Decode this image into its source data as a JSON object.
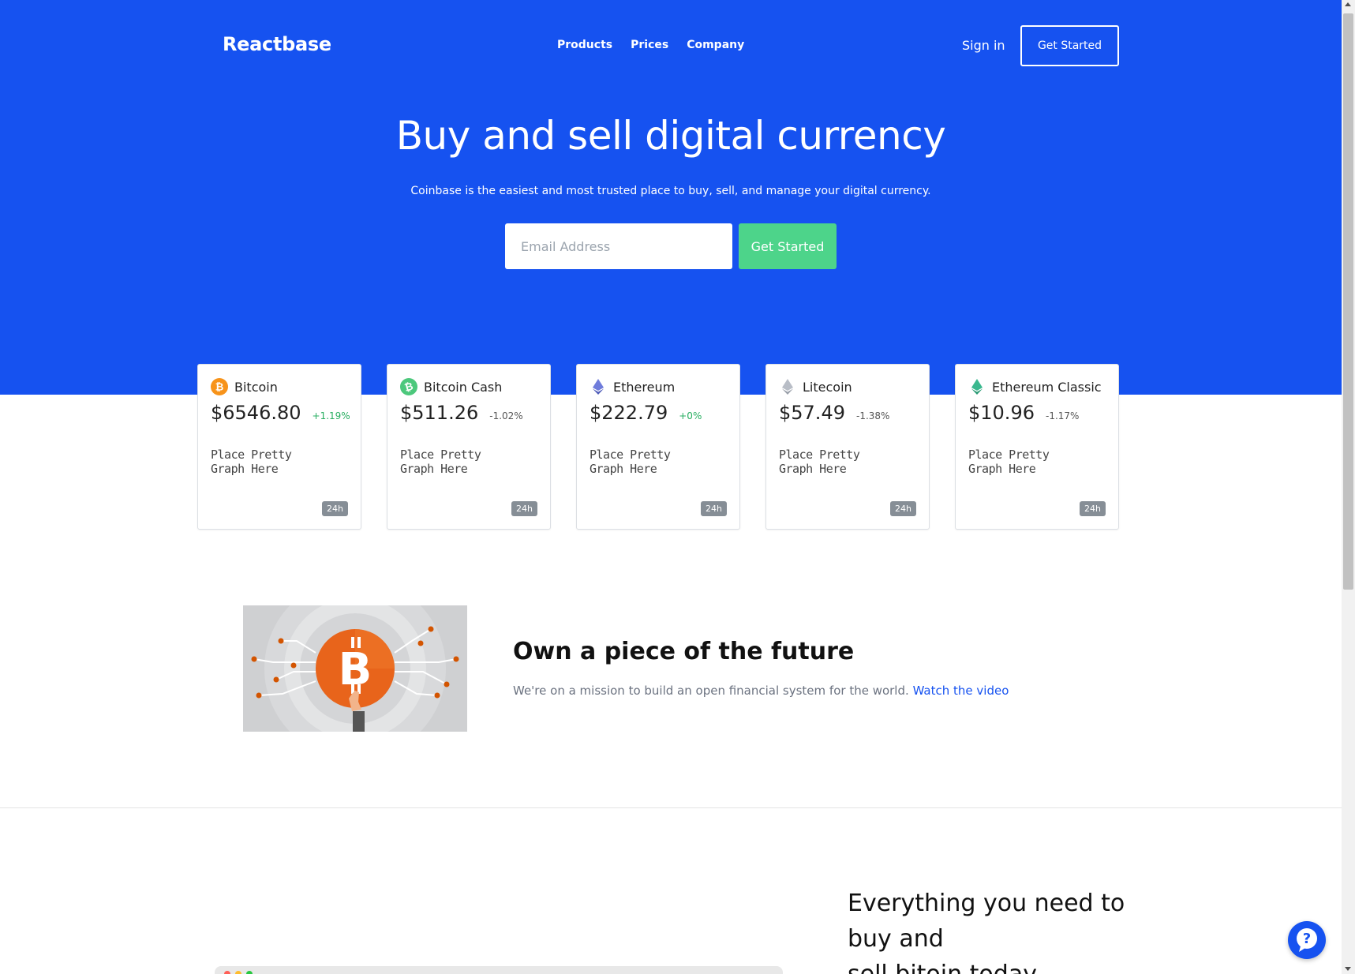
{
  "header": {
    "logo": "Reactbase",
    "nav": [
      {
        "label": "Products"
      },
      {
        "label": "Prices"
      },
      {
        "label": "Company"
      }
    ],
    "sign_in": "Sign in",
    "get_started": "Get Started"
  },
  "hero": {
    "title": "Buy and sell digital currency",
    "subtitle": "Coinbase is the easiest and most trusted place to buy, sell, and manage your digital currency.",
    "email_placeholder": "Email Address",
    "cta": "Get Started"
  },
  "coins": [
    {
      "name": "Bitcoin",
      "price": "$6546.80",
      "change": "+1.19%",
      "graph": "Place Pretty Graph Here",
      "badge": "24h",
      "icon": "bitcoin-icon",
      "color": "#f7931a"
    },
    {
      "name": "Bitcoin Cash",
      "price": "$511.26",
      "change": "-1.02%",
      "graph": "Place Pretty Graph Here",
      "badge": "24h",
      "icon": "bitcoin-cash-icon",
      "color": "#4cc87c"
    },
    {
      "name": "Ethereum",
      "price": "$222.79",
      "change": "+0%",
      "graph": "Place Pretty Graph Here",
      "badge": "24h",
      "icon": "ethereum-icon",
      "color": "#6f7cdb"
    },
    {
      "name": "Litecoin",
      "price": "$57.49",
      "change": "-1.38%",
      "graph": "Place Pretty Graph Here",
      "badge": "24h",
      "icon": "litecoin-icon",
      "color": "#b8bdc6"
    },
    {
      "name": "Ethereum Classic",
      "price": "$10.96",
      "change": "-1.17%",
      "graph": "Place Pretty Graph Here",
      "badge": "24h",
      "icon": "ethereum-classic-icon",
      "color": "#3ab88e"
    }
  ],
  "feature": {
    "title": "Own a piece of the future",
    "text": "We're on a mission to build an open financial system for the world.",
    "link": "Watch the video"
  },
  "bottom": {
    "line1": "Everything you need to",
    "line2": "buy and",
    "line3": "sell bitoin today"
  },
  "colors": {
    "brand": "#1652f0",
    "cta_green": "#4dd48a",
    "positive": "#27ae60"
  }
}
